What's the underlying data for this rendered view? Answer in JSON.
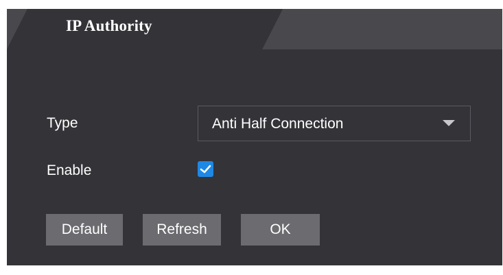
{
  "tab": {
    "label": "IP Authority"
  },
  "form": {
    "type_label": "Type",
    "type_value": "Anti Half Connection",
    "enable_label": "Enable",
    "enable_checked": true
  },
  "buttons": {
    "default_label": "Default",
    "refresh_label": "Refresh",
    "ok_label": "OK"
  },
  "icons": {
    "dropdown": "chevron-down-icon",
    "check": "checkmark-icon"
  },
  "colors": {
    "panel_background": "#333338",
    "tab_strip_background": "#48484d",
    "button_background": "#6b6b70",
    "checkbox_accent": "#1e88e5"
  }
}
